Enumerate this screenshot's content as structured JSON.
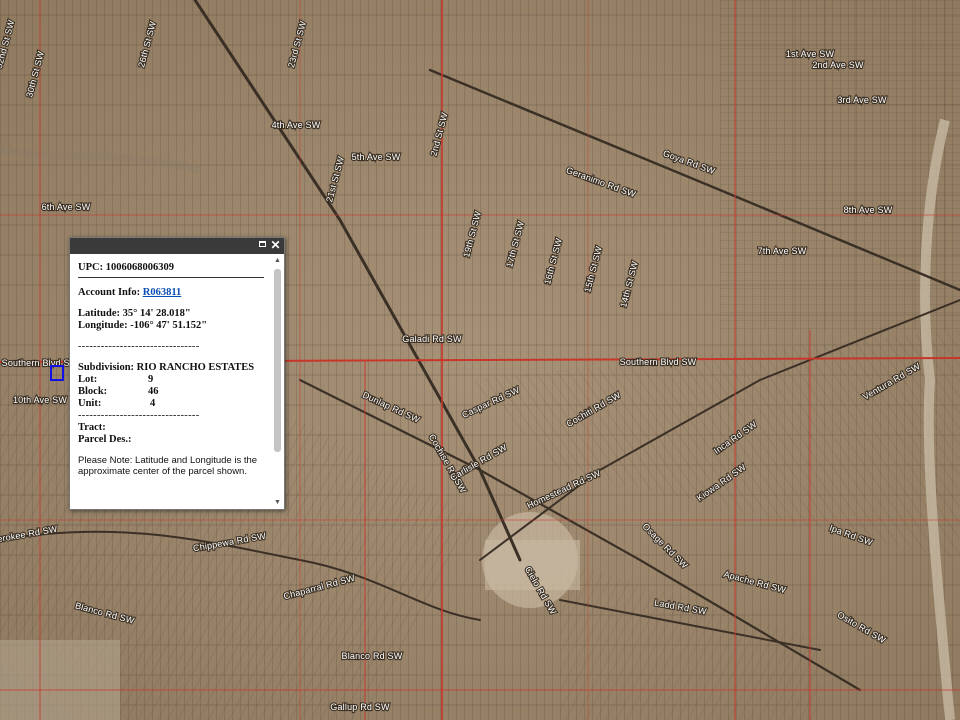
{
  "map": {
    "road_labels": [
      {
        "text": "52nd St SW",
        "rot": -75
      },
      {
        "text": "30th St SW",
        "rot": -75
      },
      {
        "text": "26th St SW",
        "rot": -75
      },
      {
        "text": "23rd St SW",
        "rot": -75
      },
      {
        "text": "21st St SW",
        "rot": -75
      },
      {
        "text": "2nd St SW",
        "rot": -75
      },
      {
        "text": "19th St SW",
        "rot": -75
      },
      {
        "text": "17th St SW",
        "rot": -75
      },
      {
        "text": "16th St SW",
        "rot": -75
      },
      {
        "text": "15th St SW",
        "rot": -75
      },
      {
        "text": "14th St SW",
        "rot": -75
      },
      {
        "text": "1st Ave SW",
        "rot": 0
      },
      {
        "text": "2nd Ave SW",
        "rot": 0
      },
      {
        "text": "3rd Ave SW",
        "rot": 0
      },
      {
        "text": "4th Ave SW",
        "rot": 0
      },
      {
        "text": "5th Ave SW",
        "rot": 0
      },
      {
        "text": "6th Ave SW",
        "rot": 0
      },
      {
        "text": "7th Ave SW",
        "rot": 0
      },
      {
        "text": "8th Ave SW",
        "rot": 0
      },
      {
        "text": "Goya Rd SW",
        "rot": 20
      },
      {
        "text": "Geranimo Rd SW",
        "rot": 20
      },
      {
        "text": "Southern Blvd SW",
        "rot": 0
      },
      {
        "text": "Southern Blvd SW",
        "rot": 0
      },
      {
        "text": "Galadi Rd SW",
        "rot": 0
      },
      {
        "text": "10th Ave SW",
        "rot": 0
      },
      {
        "text": "Dunlap Rd SW",
        "rot": 25
      },
      {
        "text": "Cochise Rd SW",
        "rot": 60
      },
      {
        "text": "Caspar Rd SW",
        "rot": -25
      },
      {
        "text": "Cochiti Rd SW",
        "rot": -30
      },
      {
        "text": "Carlisle Rd SW",
        "rot": -30
      },
      {
        "text": "Homestead Rd SW",
        "rot": -25
      },
      {
        "text": "Inca Rd SW",
        "rot": -35
      },
      {
        "text": "Kiowa Rd SW",
        "rot": -35
      },
      {
        "text": "Chippewa Rd SW",
        "rot": -10
      },
      {
        "text": "Cherokee Rd SW",
        "rot": -10
      },
      {
        "text": "Chaparral Rd SW",
        "rot": -15
      },
      {
        "text": "Blanco Rd SW",
        "rot": 15
      },
      {
        "text": "Blanco Rd SW",
        "rot": 0
      },
      {
        "text": "Cielo Rd SW",
        "rot": 60
      },
      {
        "text": "Osage Rd SW",
        "rot": 45
      },
      {
        "text": "Apache Rd SW",
        "rot": 15
      },
      {
        "text": "Ladd Rd SW",
        "rot": 10
      },
      {
        "text": "Osito Rd SW",
        "rot": 30
      },
      {
        "text": "Ventura Rd SW",
        "rot": -30
      },
      {
        "text": "Ipa Rd SW",
        "rot": 20
      },
      {
        "text": "Gallup Rd SW",
        "rot": 0
      }
    ]
  },
  "popup": {
    "upc": "UPC: 1006068006309",
    "account_label": "Account Info:",
    "account_link": "R063811",
    "latitude": "Latitude: 35° 14' 28.018\"",
    "longitude": "Longitude: -106° 47' 51.152\"",
    "divider": "--------------------------------",
    "subdivision": "Subdivision: RIO RANCHO ESTATES",
    "lot_label": "Lot:",
    "lot_value": "9",
    "block_label": "Block:",
    "block_value": "46",
    "unit_label": "Unit:",
    "unit_value": "4",
    "divider2": "--------------------------------",
    "tract": "Tract:",
    "parcel_des": "Parcel Des.:",
    "note": "Please Note: Latitude and Longitude is the approximate center of the parcel shown."
  }
}
